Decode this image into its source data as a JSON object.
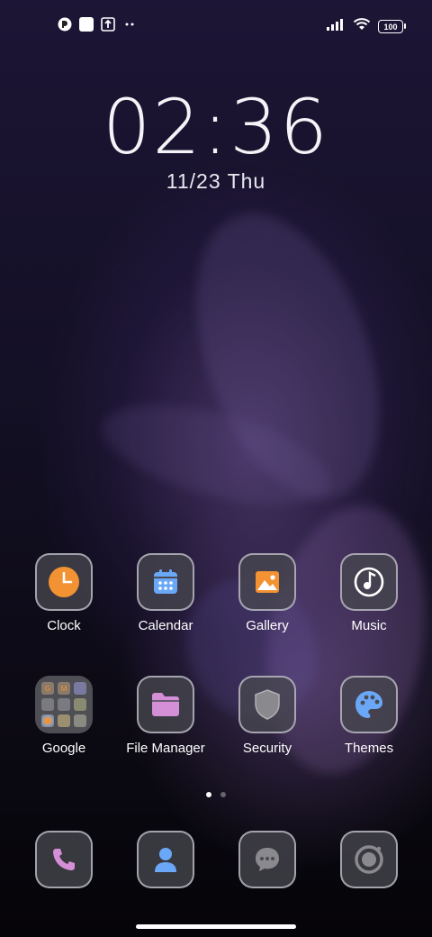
{
  "status_bar": {
    "left_icons": [
      "app-notification-icon",
      "square-notification-icon",
      "upload-icon",
      "more-dots-icon"
    ],
    "battery": "100"
  },
  "lockclock": {
    "time": "02:36",
    "date": "11/23 Thu"
  },
  "apps_row1": [
    {
      "label": "Clock",
      "icon": "clock-icon",
      "color": "#f39233"
    },
    {
      "label": "Calendar",
      "icon": "calendar-icon",
      "color": "#6aa8f7"
    },
    {
      "label": "Gallery",
      "icon": "gallery-icon",
      "color": "#f39233"
    },
    {
      "label": "Music",
      "icon": "music-icon",
      "color": "#ffffff"
    }
  ],
  "apps_row2": [
    {
      "label": "Google",
      "icon": "google-folder-icon"
    },
    {
      "label": "File Manager",
      "icon": "folder-icon",
      "color": "#d58fd6"
    },
    {
      "label": "Security",
      "icon": "shield-icon",
      "color": "#8a8a8e"
    },
    {
      "label": "Themes",
      "icon": "palette-icon",
      "color": "#6aa8f7"
    }
  ],
  "google_folder_items": [
    "G",
    "M",
    "",
    "",
    "",
    "",
    "",
    "",
    ""
  ],
  "dock": [
    {
      "icon": "phone-icon",
      "color": "#d58fd6"
    },
    {
      "icon": "contacts-icon",
      "color": "#6aa8f7"
    },
    {
      "icon": "messages-icon",
      "color": "#8a8a8e"
    },
    {
      "icon": "camera-icon",
      "color": "#8a8a8e"
    }
  ],
  "page_indicator": {
    "pages": 2,
    "current": 1
  }
}
